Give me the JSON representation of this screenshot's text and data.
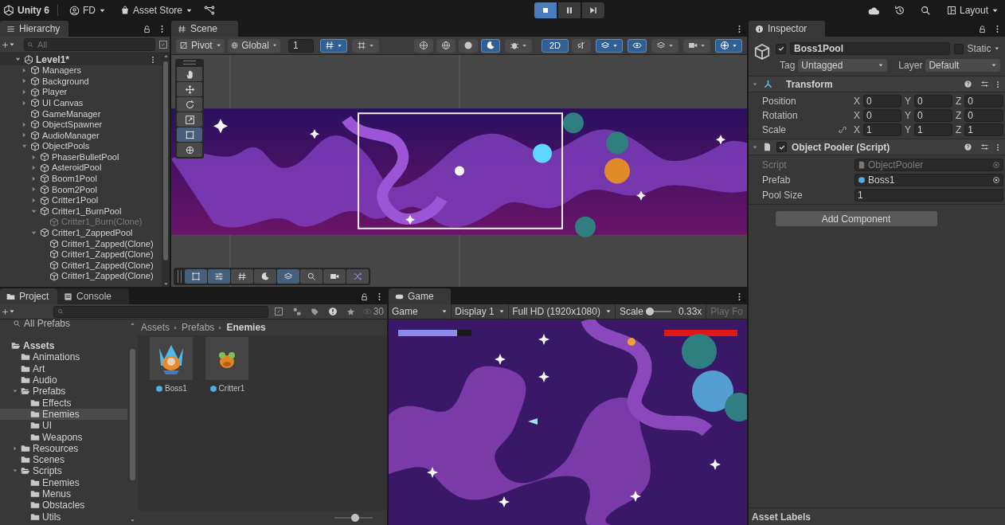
{
  "top_bar": {
    "app": "Unity 6",
    "account": "FD",
    "store": "Asset Store",
    "playing": true,
    "paused": false,
    "layout": "Layout"
  },
  "hierarchy": {
    "title": "Hierarchy",
    "search_placeholder": "All",
    "scene": "Level1*",
    "items": [
      {
        "label": "Managers",
        "kind": "collapsed",
        "disabled": false
      },
      {
        "label": "Background",
        "kind": "collapsed",
        "disabled": false
      },
      {
        "label": "Player",
        "kind": "collapsed",
        "disabled": false
      },
      {
        "label": "UI Canvas",
        "kind": "collapsed",
        "disabled": false
      },
      {
        "label": "GameManager",
        "kind": "leaf",
        "disabled": false
      },
      {
        "label": "ObjectSpawner",
        "kind": "collapsed",
        "disabled": false
      },
      {
        "label": "AudioManager",
        "kind": "collapsed",
        "disabled": false
      },
      {
        "label": "ObjectPools",
        "kind": "expanded",
        "disabled": false,
        "children": [
          {
            "label": "PhaserBulletPool",
            "kind": "collapsed",
            "disabled": false
          },
          {
            "label": "AsteroidPool",
            "kind": "collapsed",
            "disabled": false
          },
          {
            "label": "Boom1Pool",
            "kind": "collapsed",
            "disabled": false
          },
          {
            "label": "Boom2Pool",
            "kind": "collapsed",
            "disabled": false
          },
          {
            "label": "Critter1Pool",
            "kind": "collapsed",
            "disabled": false
          },
          {
            "label": "Critter1_BurnPool",
            "kind": "expanded",
            "disabled": false,
            "children": [
              {
                "label": "Critter1_Burn(Clone)",
                "kind": "leaf",
                "disabled": true
              }
            ]
          },
          {
            "label": "Critter1_ZappedPool",
            "kind": "expanded",
            "disabled": false,
            "children": [
              {
                "label": "Critter1_Zapped(Clone)",
                "kind": "leaf",
                "disabled": false
              },
              {
                "label": "Critter1_Zapped(Clone)",
                "kind": "leaf",
                "disabled": false
              },
              {
                "label": "Critter1_Zapped(Clone)",
                "kind": "leaf",
                "disabled": false
              },
              {
                "label": "Critter1_Zapped(Clone)",
                "kind": "leaf",
                "disabled": false
              }
            ]
          }
        ]
      }
    ]
  },
  "scene_view": {
    "tab": "Scene",
    "pivot": "Pivot",
    "space": "Global",
    "snap_value": "1",
    "toggles": [
      {
        "kind": "snap",
        "on": true
      },
      {
        "kind": "grid",
        "on": false
      },
      {
        "kind": "wire",
        "on": false
      },
      {
        "kind": "shaded-wire",
        "on": false
      },
      {
        "kind": "shaded",
        "on": false
      },
      {
        "kind": "unlit",
        "on": true
      },
      {
        "kind": "debug",
        "on": false
      },
      {
        "kind": "mode-2d",
        "on": true,
        "label": "2D"
      },
      {
        "kind": "audio",
        "on": false
      },
      {
        "kind": "effects",
        "on": true
      },
      {
        "kind": "visibility",
        "on": true
      },
      {
        "kind": "layers",
        "on": false
      },
      {
        "kind": "camera",
        "on": false
      },
      {
        "kind": "gizmos",
        "on": true
      }
    ],
    "tools": [
      {
        "kind": "hand",
        "selected": false
      },
      {
        "kind": "move",
        "selected": false
      },
      {
        "kind": "rotate",
        "selected": false
      },
      {
        "kind": "scale",
        "selected": false
      },
      {
        "kind": "rect",
        "selected": true
      },
      {
        "kind": "transform",
        "selected": false
      }
    ],
    "overlay_tools": [
      {
        "kind": "rect",
        "on": true
      },
      {
        "kind": "sliders",
        "on": true
      },
      {
        "kind": "grid",
        "on": false
      },
      {
        "kind": "unlit",
        "on": false
      },
      {
        "kind": "layers",
        "on": true
      },
      {
        "kind": "search",
        "on": false
      },
      {
        "kind": "camera",
        "on": false
      },
      {
        "kind": "shuffle",
        "on": false
      }
    ]
  },
  "inspector": {
    "title": "Inspector",
    "object": {
      "name": "Boss1Pool",
      "active": true,
      "static": false,
      "static_label": "Static",
      "tag_label": "Tag",
      "tag": "Untagged",
      "layer_label": "Layer",
      "layer": "Default"
    },
    "components": [
      {
        "kind": "transform",
        "title": "Transform",
        "expanded": true,
        "rows": [
          {
            "label": "Position",
            "link_toggle": false,
            "axes": [
              "X",
              "Y",
              "Z"
            ],
            "values": [
              "0",
              "0",
              "0"
            ]
          },
          {
            "label": "Rotation",
            "link_toggle": false,
            "axes": [
              "X",
              "Y",
              "Z"
            ],
            "values": [
              "0",
              "0",
              "0"
            ]
          },
          {
            "label": "Scale",
            "link_toggle": true,
            "axes": [
              "X",
              "Y",
              "Z"
            ],
            "values": [
              "1",
              "1",
              "1"
            ]
          }
        ]
      },
      {
        "kind": "script",
        "title": "Object Pooler (Script)",
        "expanded": true,
        "enabled": true,
        "fields": [
          {
            "label": "Script",
            "kind": "script",
            "value": "ObjectPooler",
            "disabled": true
          },
          {
            "label": "Prefab",
            "kind": "prefab",
            "value": "Boss1",
            "disabled": false
          },
          {
            "label": "Pool Size",
            "kind": "number",
            "value": "1",
            "disabled": false
          }
        ]
      }
    ],
    "add_component": "Add Component",
    "asset_labels": "Asset Labels"
  },
  "project": {
    "tabs": [
      {
        "label": "Project",
        "selected": true
      },
      {
        "label": "Console",
        "selected": false
      }
    ],
    "hidden_count": "30",
    "favorite": "All Prefabs",
    "tree": [
      {
        "label": "Assets",
        "kind": "expanded",
        "selected": false,
        "children": [
          {
            "label": "Animations",
            "kind": "leaf",
            "selected": false
          },
          {
            "label": "Art",
            "kind": "leaf",
            "selected": false
          },
          {
            "label": "Audio",
            "kind": "leaf",
            "selected": false
          },
          {
            "label": "Prefabs",
            "kind": "expanded",
            "selected": false,
            "children": [
              {
                "label": "Effects",
                "kind": "leaf",
                "selected": false
              },
              {
                "label": "Enemies",
                "kind": "leaf",
                "selected": true
              },
              {
                "label": "UI",
                "kind": "leaf",
                "selected": false
              },
              {
                "label": "Weapons",
                "kind": "leaf",
                "selected": false
              }
            ]
          },
          {
            "label": "Resources",
            "kind": "collapsed",
            "selected": false
          },
          {
            "label": "Scenes",
            "kind": "leaf",
            "selected": false
          },
          {
            "label": "Scripts",
            "kind": "expanded",
            "selected": false,
            "children": [
              {
                "label": "Enemies",
                "kind": "leaf",
                "selected": false
              },
              {
                "label": "Menus",
                "kind": "leaf",
                "selected": false
              },
              {
                "label": "Obstacles",
                "kind": "leaf",
                "selected": false
              },
              {
                "label": "Utils",
                "kind": "leaf",
                "selected": false
              }
            ]
          }
        ]
      }
    ],
    "breadcrumb": [
      "Assets",
      "Prefabs",
      "Enemies"
    ],
    "assets": [
      {
        "name": "Boss1",
        "kind": "boss"
      },
      {
        "name": "Critter1",
        "kind": "critter"
      }
    ],
    "zoom": {
      "level": 0.55
    }
  },
  "game_view": {
    "tab": "Game",
    "mode": "Game",
    "display": "Display 1",
    "resolution": "Full HD (1920x1080)",
    "scale_label": "Scale",
    "scale": {
      "level": 0.1
    },
    "scale_value": "0.33x",
    "play_focused": "Play Fo"
  }
}
